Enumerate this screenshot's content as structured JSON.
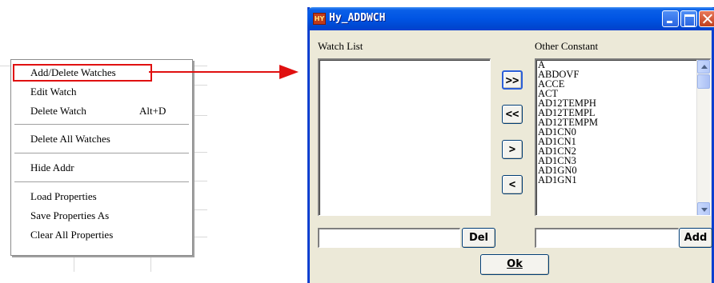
{
  "context_menu": {
    "items": [
      {
        "label": "Add/Delete Watches",
        "shortcut": "",
        "highlighted": true
      },
      {
        "label": "Edit Watch",
        "shortcut": ""
      },
      {
        "label": "Delete Watch",
        "shortcut": "Alt+D"
      },
      {
        "label": "Delete All Watches",
        "shortcut": ""
      },
      {
        "label": "Hide Addr",
        "shortcut": ""
      },
      {
        "label": "Load Properties",
        "shortcut": ""
      },
      {
        "label": "Save Properties As",
        "shortcut": ""
      },
      {
        "label": "Clear All Properties",
        "shortcut": ""
      }
    ]
  },
  "dialog": {
    "title": "Hy_ADDWCH",
    "icon_text": "HY",
    "watch_list_label": "Watch List",
    "other_constant_label": "Other Constant",
    "constants": [
      "A",
      "ABDOVF",
      "ACCE",
      "ACT",
      "AD12TEMPH",
      "AD12TEMPL",
      "AD12TEMPM",
      "AD1CN0",
      "AD1CN1",
      "AD1CN2",
      "AD1CN3",
      "AD1GN0",
      "AD1GN1"
    ],
    "move_buttons": [
      ">>",
      "<<",
      ">",
      "<"
    ],
    "watch_input_value": "",
    "constant_input_value": "",
    "del_label": "Del",
    "add_label": "Add",
    "ok_label": "Ok"
  },
  "colors": {
    "titlebar": "#0054e3",
    "dialog_bg": "#ece9d8",
    "highlight": "#e01010"
  }
}
